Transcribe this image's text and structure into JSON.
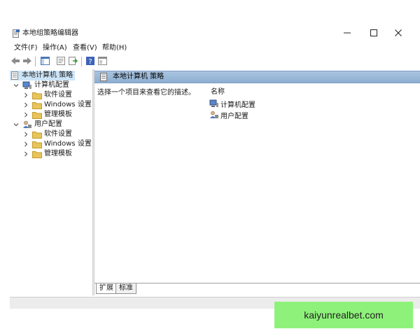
{
  "window": {
    "title": "本地组策略编辑器"
  },
  "menu": {
    "file": "文件(F)",
    "action": "操作(A)",
    "view": "查看(V)",
    "help": "帮助(H)"
  },
  "toolbar": {
    "icons": [
      "back-arrow-icon",
      "forward-arrow-icon",
      "show-hide-tree-icon",
      "properties-icon",
      "export-list-icon",
      "help-icon",
      "extended-view-icon"
    ]
  },
  "tree": {
    "root": "本地计算机 策略",
    "computer_config": "计算机配置",
    "computer_children": [
      "软件设置",
      "Windows 设置",
      "管理模板"
    ],
    "user_config": "用户配置",
    "user_children": [
      "软件设置",
      "Windows 设置",
      "管理模板"
    ]
  },
  "pane": {
    "header_title": "本地计算机 策略",
    "description": "选择一个项目来查看它的描述。",
    "column_name": "名称",
    "items": [
      "计算机配置",
      "用户配置"
    ]
  },
  "tabs": {
    "extended": "扩展",
    "standard": "标准"
  },
  "watermark": {
    "text": "kaiyunrealbet.com"
  },
  "colors": {
    "header_blue": "#8eaed1",
    "selection": "#cce4f7",
    "watermark_green": "#8ef27a",
    "folder_yellow": "#e8c55a"
  }
}
